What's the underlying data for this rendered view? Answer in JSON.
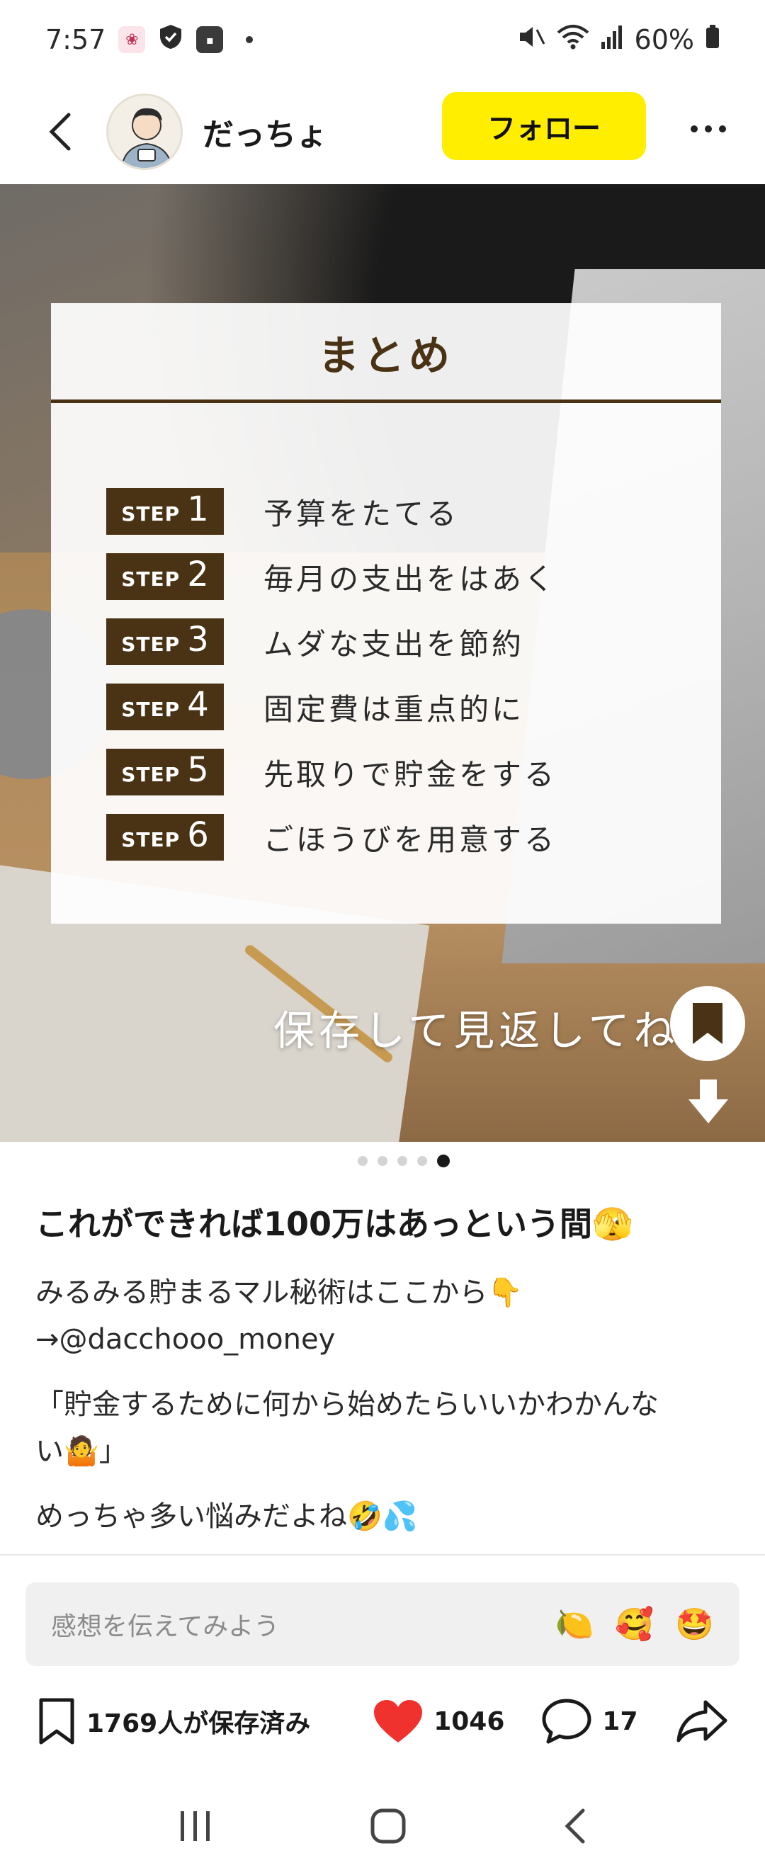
{
  "status_bar": {
    "time": "7:57",
    "battery": "60%"
  },
  "header": {
    "username": "だっちょ",
    "follow_label": "フォロー"
  },
  "card": {
    "title": "まとめ",
    "steps": [
      {
        "word": "STEP",
        "num": "1",
        "text": "予算をたてる"
      },
      {
        "word": "STEP",
        "num": "2",
        "text": "毎月の支出をはあく"
      },
      {
        "word": "STEP",
        "num": "3",
        "text": "ムダな支出を節約"
      },
      {
        "word": "STEP",
        "num": "4",
        "text": "固定費は重点的に"
      },
      {
        "word": "STEP",
        "num": "5",
        "text": "先取りで貯金をする"
      },
      {
        "word": "STEP",
        "num": "6",
        "text": "ごほうびを用意する"
      }
    ]
  },
  "hero": {
    "save_caption": "保存して見返してね"
  },
  "pager": {
    "count": 5,
    "active": 5
  },
  "post": {
    "title": "これができれば100万はあっという間🫣",
    "line1": "みるみる貯まるマル秘術はここから👇",
    "line2": "→@dacchooo_money",
    "line3": "「貯金するために何から始めたらいいかわかんな",
    "line4": "い🤷」",
    "line5": "めっちゃ多い悩みだよね🤣💦"
  },
  "comment": {
    "placeholder": "感想を伝えてみよう",
    "emojis": [
      "🍋",
      "🥰",
      "🤩"
    ]
  },
  "actions": {
    "saved": "1769人が保存済み",
    "likes": "1046",
    "comments": "17"
  },
  "colors": {
    "follow": "#ffee00",
    "heart": "#f0322e",
    "step": "#4a3314"
  }
}
